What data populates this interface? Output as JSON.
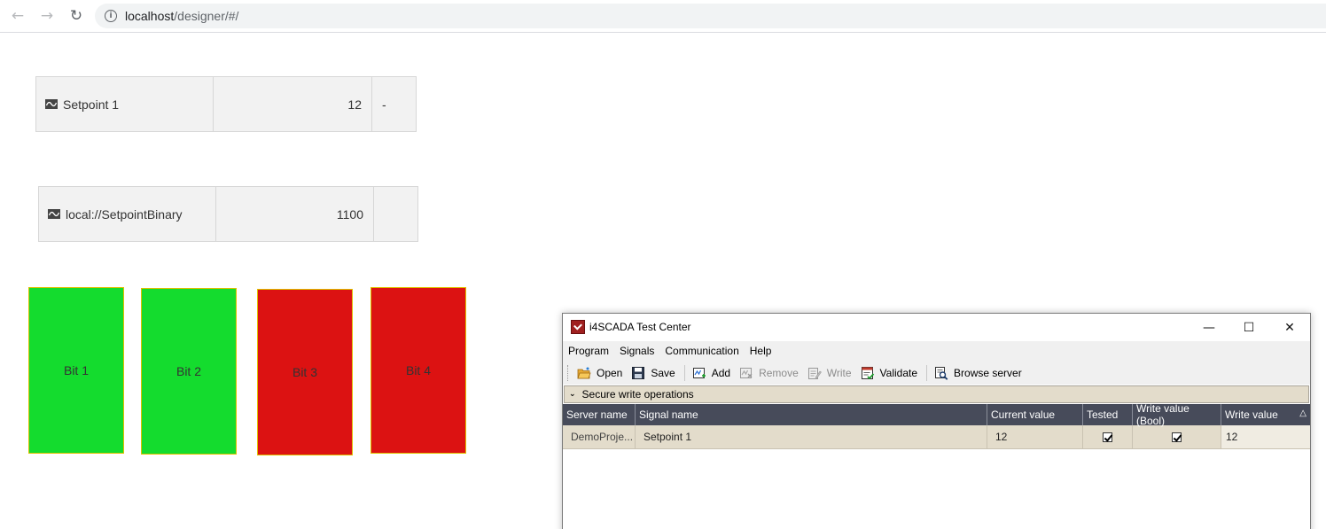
{
  "browser": {
    "url_host": "localhost",
    "url_path": "/designer/#/",
    "back_icon": "←",
    "forward_icon": "→",
    "reload_icon": "↻",
    "info_icon": "i"
  },
  "signals": [
    {
      "name": "Setpoint 1",
      "value": "12",
      "unit": "-"
    },
    {
      "name": "local://SetpointBinary",
      "value": "1100",
      "unit": ""
    }
  ],
  "bits": [
    {
      "label": "Bit 1",
      "state": "on"
    },
    {
      "label": "Bit 2",
      "state": "on"
    },
    {
      "label": "Bit 3",
      "state": "off"
    },
    {
      "label": "Bit 4",
      "state": "off"
    }
  ],
  "colors": {
    "bit_on": "#14dc2e",
    "bit_off": "#dc1212",
    "grid_header": "#474b5a",
    "row_bg": "#e3dccb"
  },
  "test_center": {
    "title": "i4SCADA Test Center",
    "controls": {
      "minimize": "—",
      "maximize": "☐",
      "close": "✕"
    },
    "menu": [
      "Program",
      "Signals",
      "Communication",
      "Help"
    ],
    "toolbar": {
      "open": "Open",
      "save": "Save",
      "add": "Add",
      "remove": "Remove",
      "write": "Write",
      "validate": "Validate",
      "browse": "Browse server"
    },
    "group_label": "Secure write operations",
    "columns": [
      "Server name",
      "Signal name",
      "Current value",
      "Tested",
      "Write value (Bool)",
      "Write value"
    ],
    "rows": [
      {
        "server": "DemoProje...",
        "signal": "Setpoint 1",
        "current": "12",
        "tested": true,
        "write_bool": true,
        "write_value": "12"
      }
    ]
  }
}
